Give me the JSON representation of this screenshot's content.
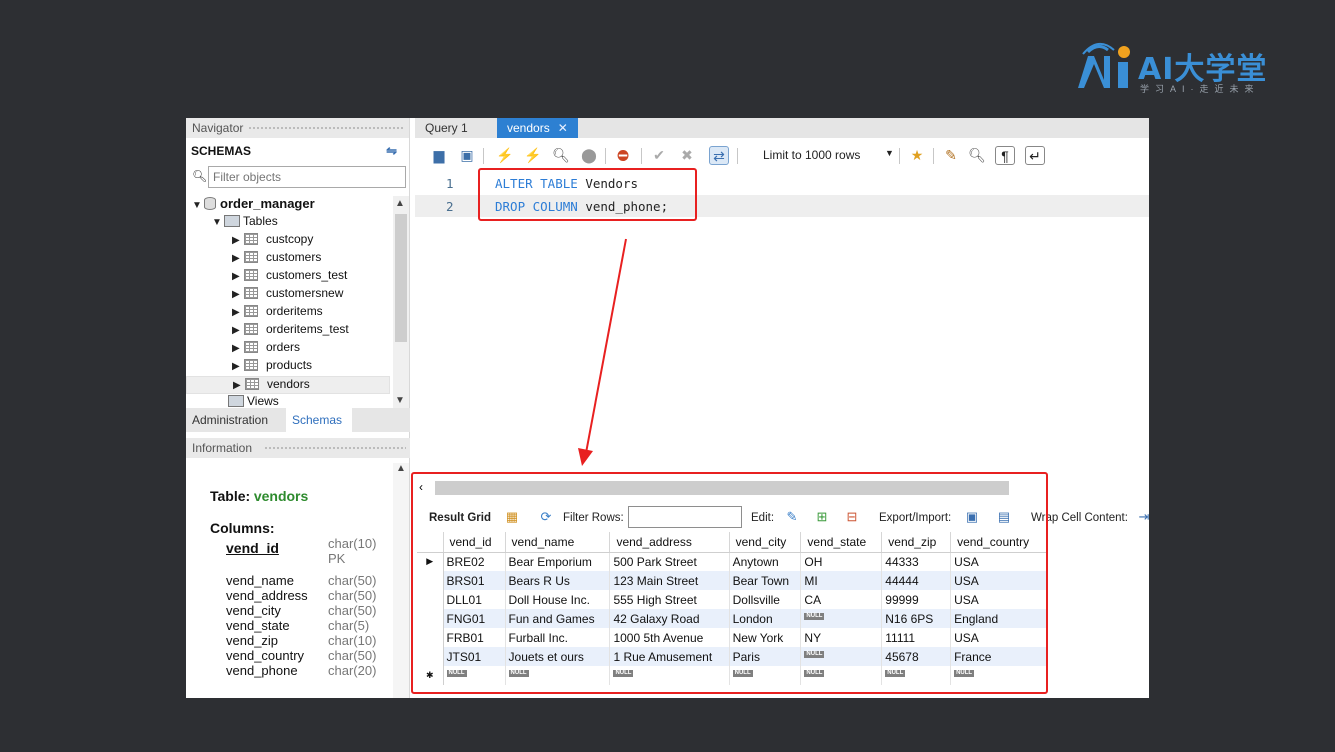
{
  "logo": {
    "text": "AI大学堂",
    "sub": "学习AI·走近未来",
    "accent": "#3a8fd6",
    "dot_color": "#f0a21f"
  },
  "navigator": {
    "title": "Navigator",
    "schemas_label": "SCHEMAS",
    "filter_placeholder": "Filter objects",
    "schema_name": "order_manager",
    "tables_label": "Tables",
    "tables": [
      "custcopy",
      "customers",
      "customers_test",
      "customersnew",
      "orderitems",
      "orderitems_test",
      "orders",
      "products",
      "vendors"
    ],
    "selected_table": "vendors",
    "views_label": "Views",
    "tab_administration": "Administration",
    "tab_schemas": "Schemas"
  },
  "information": {
    "title": "Information",
    "table_label": "Table:",
    "table_name": "vendors",
    "columns_label": "Columns:",
    "columns": [
      {
        "name": "vend_id",
        "type": "char(10)",
        "extra": "PK"
      },
      {
        "name": "vend_name",
        "type": "char(50)"
      },
      {
        "name": "vend_address",
        "type": "char(50)"
      },
      {
        "name": "vend_city",
        "type": "char(50)"
      },
      {
        "name": "vend_state",
        "type": "char(5)"
      },
      {
        "name": "vend_zip",
        "type": "char(10)"
      },
      {
        "name": "vend_country",
        "type": "char(50)"
      },
      {
        "name": "vend_phone",
        "type": "char(20)"
      }
    ]
  },
  "editor": {
    "tabs": [
      {
        "label": "Query 1",
        "active": false
      },
      {
        "label": "vendors",
        "active": true
      }
    ],
    "limit_label": "Limit to 1000 rows",
    "lines": [
      {
        "num": "1",
        "kw": "ALTER TABLE",
        "rest": " Vendors"
      },
      {
        "num": "2",
        "kw": "DROP COLUMN",
        "rest": " vend_phone;"
      }
    ]
  },
  "results": {
    "result_grid_label": "Result Grid",
    "filter_rows_label": "Filter Rows:",
    "edit_label": "Edit:",
    "export_label": "Export/Import:",
    "wrap_label": "Wrap Cell Content:",
    "null_label": "NULL",
    "columns": [
      "vend_id",
      "vend_name",
      "vend_address",
      "vend_city",
      "vend_state",
      "vend_zip",
      "vend_country"
    ],
    "rows": [
      [
        "BRE02",
        "Bear Emporium",
        "500 Park Street",
        "Anytown",
        "OH",
        "44333",
        "USA"
      ],
      [
        "BRS01",
        "Bears R Us",
        "123 Main Street",
        "Bear Town",
        "MI",
        "44444",
        "USA"
      ],
      [
        "DLL01",
        "Doll House Inc.",
        "555 High Street",
        "Dollsville",
        "CA",
        "99999",
        "USA"
      ],
      [
        "FNG01",
        "Fun and Games",
        "42 Galaxy Road",
        "London",
        "NULL",
        "N16 6PS",
        "England"
      ],
      [
        "FRB01",
        "Furball Inc.",
        "1000 5th Avenue",
        "New York",
        "NY",
        "11111",
        "USA"
      ],
      [
        "JTS01",
        "Jouets et ours",
        "1 Rue Amusement",
        "Paris",
        "NULL",
        "45678",
        "France"
      ]
    ]
  },
  "colors": {
    "annotation": "#e82020",
    "active_tab": "#2d80d2",
    "keyword": "#2d7dd6",
    "row_alt": "#e9f0fb"
  }
}
